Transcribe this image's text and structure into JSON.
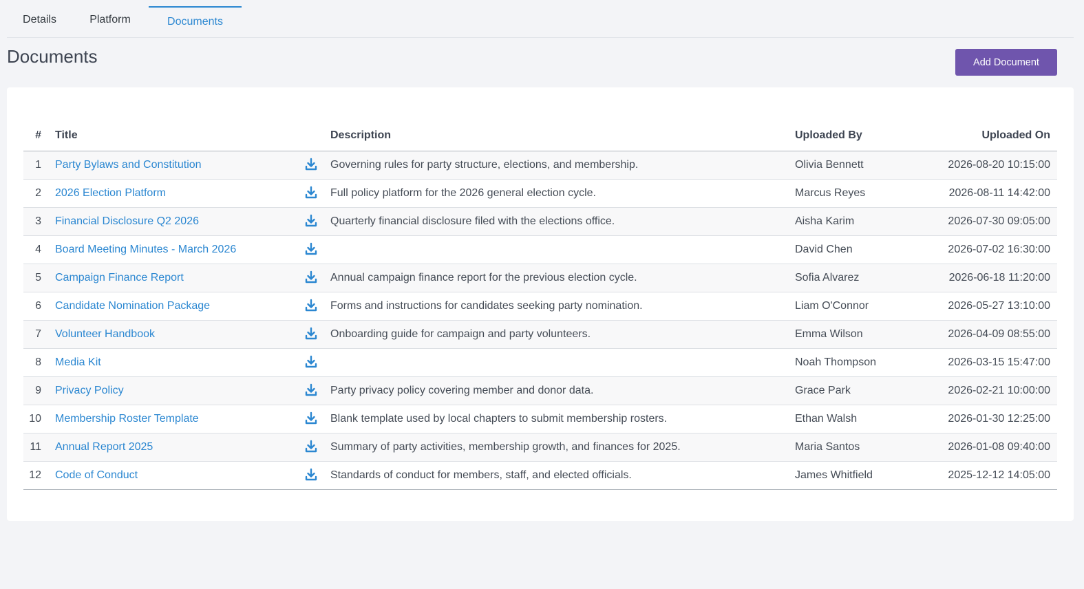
{
  "tabs": [
    {
      "label": "Details",
      "active": false
    },
    {
      "label": "Platform",
      "active": false
    },
    {
      "label": "Documents",
      "active": true
    }
  ],
  "header": {
    "title": "Documents",
    "add_button_label": "Add Document"
  },
  "colors": {
    "accent": "#2b87d1",
    "button": "#6f55ad"
  },
  "table": {
    "columns": {
      "num": "#",
      "title": "Title",
      "description": "Description",
      "uploaded_by": "Uploaded By",
      "uploaded_on": "Uploaded On"
    },
    "rows": [
      {
        "num": "1",
        "title": "Party Bylaws and Constitution",
        "description": "Governing rules for party structure, elections, and membership.",
        "uploaded_by": "Olivia Bennett",
        "uploaded_on": "2026-08-20 10:15:00"
      },
      {
        "num": "2",
        "title": "2026 Election Platform",
        "description": "Full policy platform for the 2026 general election cycle.",
        "uploaded_by": "Marcus Reyes",
        "uploaded_on": "2026-08-11 14:42:00"
      },
      {
        "num": "3",
        "title": "Financial Disclosure Q2 2026",
        "description": "Quarterly financial disclosure filed with the elections office.",
        "uploaded_by": "Aisha Karim",
        "uploaded_on": "2026-07-30 09:05:00"
      },
      {
        "num": "4",
        "title": "Board Meeting Minutes - March 2026",
        "description": "",
        "uploaded_by": "David Chen",
        "uploaded_on": "2026-07-02 16:30:00"
      },
      {
        "num": "5",
        "title": "Campaign Finance Report",
        "description": "Annual campaign finance report for the previous election cycle.",
        "uploaded_by": "Sofia Alvarez",
        "uploaded_on": "2026-06-18 11:20:00"
      },
      {
        "num": "6",
        "title": "Candidate Nomination Package",
        "description": "Forms and instructions for candidates seeking party nomination.",
        "uploaded_by": "Liam O'Connor",
        "uploaded_on": "2026-05-27 13:10:00"
      },
      {
        "num": "7",
        "title": "Volunteer Handbook",
        "description": "Onboarding guide for campaign and party volunteers.",
        "uploaded_by": "Emma Wilson",
        "uploaded_on": "2026-04-09 08:55:00"
      },
      {
        "num": "8",
        "title": "Media Kit",
        "description": "",
        "uploaded_by": "Noah Thompson",
        "uploaded_on": "2026-03-15 15:47:00"
      },
      {
        "num": "9",
        "title": "Privacy Policy",
        "description": "Party privacy policy covering member and donor data.",
        "uploaded_by": "Grace Park",
        "uploaded_on": "2026-02-21 10:00:00"
      },
      {
        "num": "10",
        "title": "Membership Roster Template",
        "description": "Blank template used by local chapters to submit membership rosters.",
        "uploaded_by": "Ethan Walsh",
        "uploaded_on": "2026-01-30 12:25:00"
      },
      {
        "num": "11",
        "title": "Annual Report 2025",
        "description": "Summary of party activities, membership growth, and finances for 2025.",
        "uploaded_by": "Maria Santos",
        "uploaded_on": "2026-01-08 09:40:00"
      },
      {
        "num": "12",
        "title": "Code of Conduct",
        "description": "Standards of conduct for members, staff, and elected officials.",
        "uploaded_by": "James Whitfield",
        "uploaded_on": "2025-12-12 14:05:00"
      }
    ]
  }
}
